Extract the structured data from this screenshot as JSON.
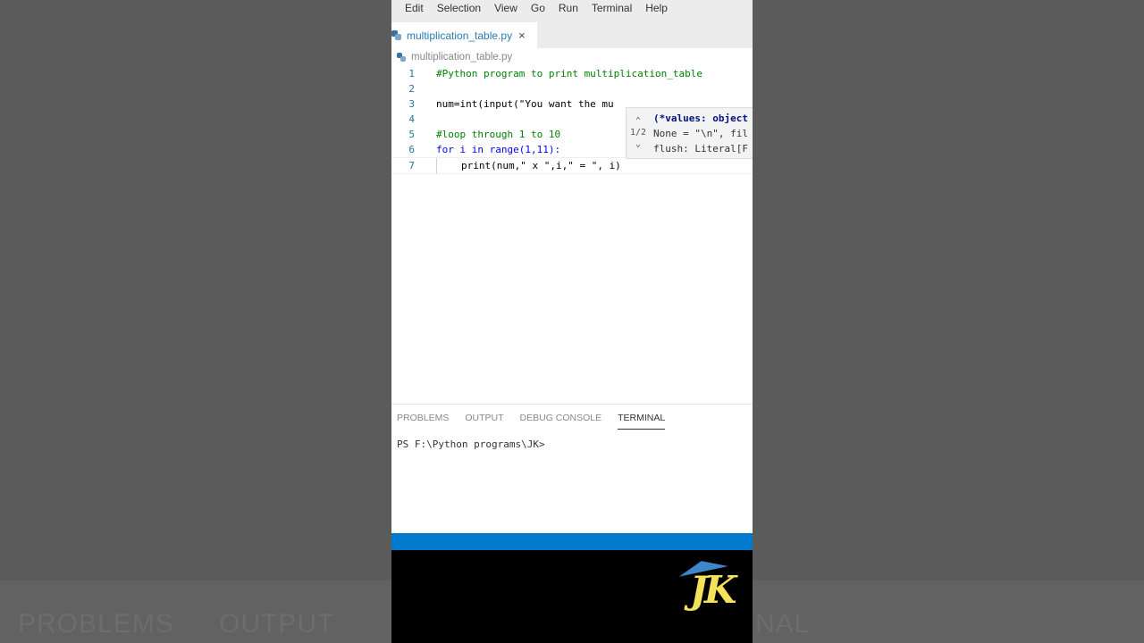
{
  "menu": [
    "Edit",
    "Selection",
    "View",
    "Go",
    "Run",
    "Terminal",
    "Help"
  ],
  "tab": {
    "label": "multiplication_table.py",
    "close": "×"
  },
  "breadcrumb": "multiplication_table.py",
  "code_lines": [
    {
      "num": "1",
      "text": "#Python program to print multiplication_table"
    },
    {
      "num": "2",
      "text": ""
    },
    {
      "num": "3",
      "text": "num=int(input(\"You want the mu"
    },
    {
      "num": "4",
      "text": ""
    },
    {
      "num": "5",
      "text": "#loop through 1 to 10"
    },
    {
      "num": "6",
      "text": "for i in range(1,11):"
    },
    {
      "num": "7",
      "text": "print(num,\" x \",i,\" = \", i)"
    }
  ],
  "hover": {
    "counter": "1/2",
    "line1": "(*values: object",
    "line2": "None = \"\\n\", fil",
    "line3": "flush: Literal[F"
  },
  "panel": {
    "tabs": [
      "PROBLEMS",
      "OUTPUT",
      "DEBUG CONSOLE",
      "TERMINAL"
    ],
    "active_tab": "TERMINAL",
    "prompt": "PS F:\\Python programs\\JK>"
  },
  "logo": {
    "text": "JK"
  },
  "background_text": [
    "PROBLEMS",
    "OUTPUT",
    "NAL"
  ],
  "colors": {
    "statusbar": "#007acc",
    "accent": "#2a7ab0"
  }
}
